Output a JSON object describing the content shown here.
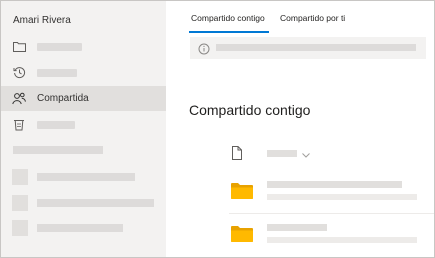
{
  "sidebar": {
    "user_name": "Amari Rivera",
    "nav": [
      {
        "icon": "folder-icon"
      },
      {
        "icon": "history-icon"
      },
      {
        "icon": "shared-people-icon",
        "label": "Compartida",
        "active": true
      },
      {
        "icon": "recycle-bin-icon"
      }
    ]
  },
  "main": {
    "tabs": [
      {
        "label": "Compartido contigo",
        "selected": true
      },
      {
        "label": "Compartido por ti",
        "selected": false
      }
    ],
    "banner_icon": "info-icon",
    "heading": "Compartido contigo",
    "header_icons": [
      "file-icon",
      "chevron-down-icon"
    ],
    "file_icons": [
      "folder-icon",
      "folder-icon"
    ]
  },
  "colors": {
    "accent": "#0078d4",
    "sidebar_bg": "#f3f2f1",
    "active_bg": "#e1dfdd",
    "folder": "#ffb900"
  }
}
